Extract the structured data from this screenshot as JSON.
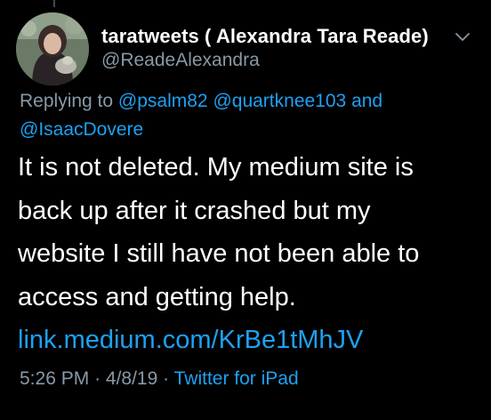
{
  "tweet": {
    "display_name": "taratweets ( Alexandra Tara Reade)",
    "handle": "@ReadeAlexandra",
    "reply_prefix": "Replying to ",
    "mentions": [
      "@psalm82",
      "@quartknee103",
      "@IsaacDovere"
    ],
    "mention_joiner": "and",
    "text": "It is not deleted. My medium site is\nback up after  it crashed but my\nwebsite I still have not been able to\naccess and getting help.",
    "link": "link.medium.com/KrBe1tMhJV",
    "time": "5:26 PM",
    "date": "4/8/19",
    "separator": "·",
    "source": "Twitter for iPad"
  },
  "icons": {
    "avatar": "profile-photo",
    "menu": "chevron-down-icon"
  },
  "colors": {
    "background": "#000000",
    "text": "#ffffff",
    "secondary": "#8899a6",
    "accent": "#1da1f2"
  }
}
